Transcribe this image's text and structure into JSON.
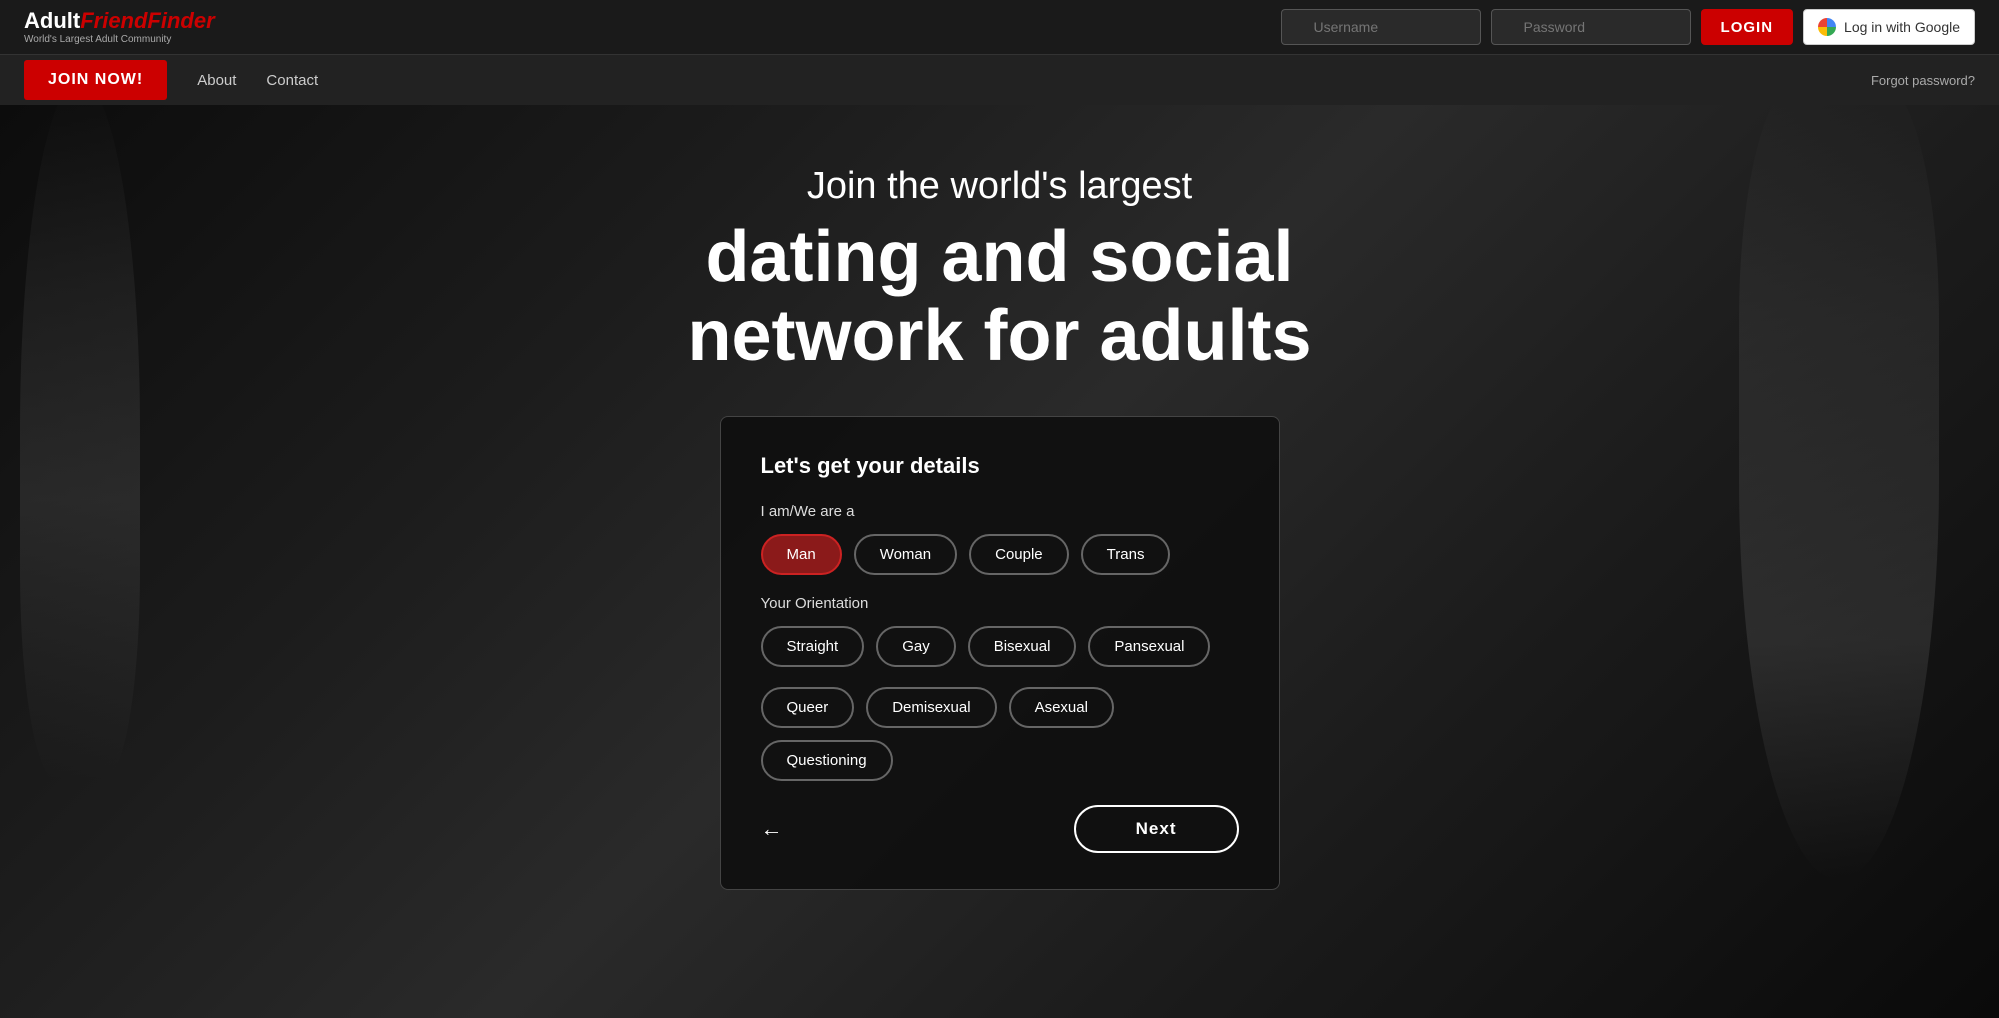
{
  "brand": {
    "adult": "Adult",
    "friend": "FriendFinder",
    "tagline": "World's Largest Adult Community"
  },
  "navbar": {
    "username_placeholder": "Username",
    "password_placeholder": "Password",
    "login_label": "LOGIN",
    "google_login_label": "Log in with Google"
  },
  "subnav": {
    "join_label": "JOIN NOW!",
    "about_label": "About",
    "contact_label": "Contact",
    "forgot_label": "Forgot password?"
  },
  "hero": {
    "subtitle": "Join the world's largest",
    "title_line1": "dating and social",
    "title_line2": "network for adults"
  },
  "card": {
    "title": "Let's get your details",
    "identity_label": "I am/We are a",
    "identity_options": [
      {
        "id": "man",
        "label": "Man",
        "selected": true
      },
      {
        "id": "woman",
        "label": "Woman",
        "selected": false
      },
      {
        "id": "couple",
        "label": "Couple",
        "selected": false
      },
      {
        "id": "trans",
        "label": "Trans",
        "selected": false
      }
    ],
    "orientation_label": "Your Orientation",
    "orientation_row1": [
      {
        "id": "straight",
        "label": "Straight",
        "selected": false
      },
      {
        "id": "gay",
        "label": "Gay",
        "selected": false
      },
      {
        "id": "bisexual",
        "label": "Bisexual",
        "selected": false
      },
      {
        "id": "pansexual",
        "label": "Pansexual",
        "selected": false
      }
    ],
    "orientation_row2": [
      {
        "id": "queer",
        "label": "Queer",
        "selected": false
      },
      {
        "id": "demisexual",
        "label": "Demisexual",
        "selected": false
      },
      {
        "id": "asexual",
        "label": "Asexual",
        "selected": false
      },
      {
        "id": "questioning",
        "label": "Questioning",
        "selected": false
      }
    ],
    "back_icon": "←",
    "next_label": "Next"
  }
}
